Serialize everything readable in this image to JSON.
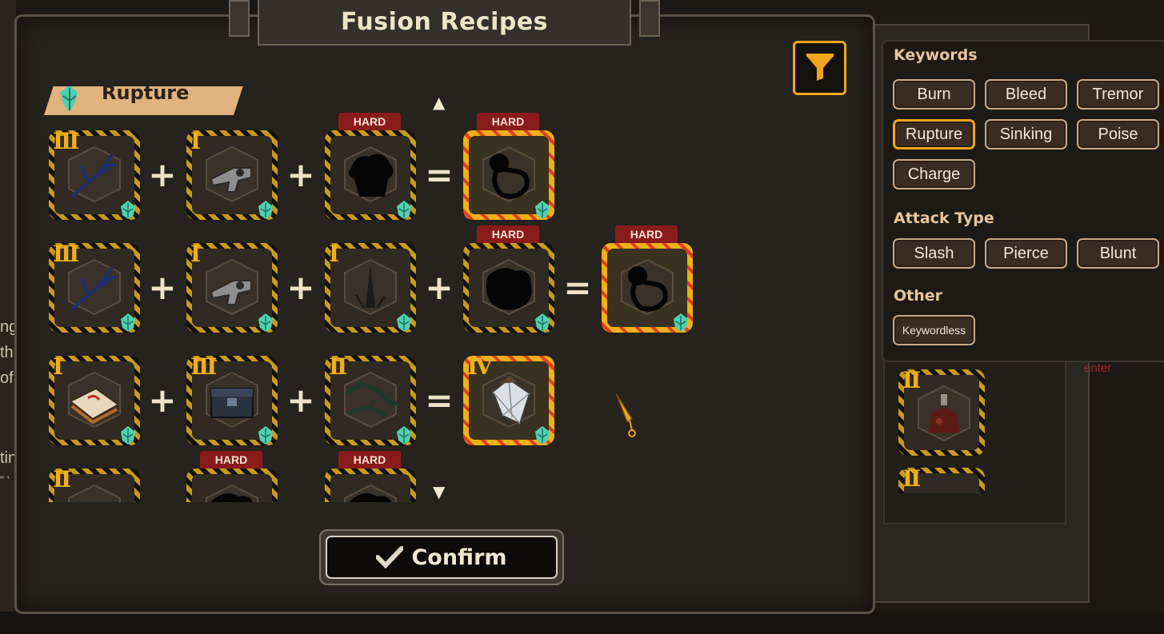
{
  "title": "Fusion Recipes",
  "section": {
    "label": "Rupture"
  },
  "hard_label": "HARD",
  "recipes": [
    {
      "ingredients": [
        {
          "tier": "III",
          "hard": false,
          "art": "branch"
        },
        {
          "tier": "I",
          "hard": false,
          "art": "gun"
        },
        {
          "tier": "",
          "hard": true,
          "art": "silhouette-tree"
        }
      ],
      "result": {
        "tier": "",
        "hard": true,
        "art": "silhouette-ring"
      }
    },
    {
      "ingredients": [
        {
          "tier": "III",
          "hard": false,
          "art": "branch"
        },
        {
          "tier": "I",
          "hard": false,
          "art": "gun"
        },
        {
          "tier": "I",
          "hard": false,
          "art": "spike"
        },
        {
          "tier": "",
          "hard": true,
          "art": "silhouette-blob"
        }
      ],
      "result": {
        "tier": "",
        "hard": true,
        "art": "silhouette-ring"
      }
    },
    {
      "ingredients": [
        {
          "tier": "I",
          "hard": false,
          "art": "book"
        },
        {
          "tier": "III",
          "hard": false,
          "art": "box"
        },
        {
          "tier": "II",
          "hard": false,
          "art": "thorns"
        }
      ],
      "result": {
        "tier": "IV",
        "hard": false,
        "art": "crystal"
      }
    },
    {
      "ingredients": [
        {
          "tier": "II",
          "hard": false,
          "art": "misc"
        },
        {
          "tier": "",
          "hard": true,
          "art": "silhouette-blob"
        },
        {
          "tier": "",
          "hard": true,
          "art": "silhouette-blob"
        }
      ],
      "result": null
    }
  ],
  "confirm_label": "Confirm",
  "filters": {
    "keywords_title": "Keywords",
    "keywords": [
      "Burn",
      "Bleed",
      "Tremor",
      "Rupture",
      "Sinking",
      "Poise",
      "Charge"
    ],
    "active_keyword": "Rupture",
    "attack_title": "Attack Type",
    "attack_types": [
      "Slash",
      "Pierce",
      "Blunt"
    ],
    "other_title": "Other",
    "other": [
      "Keywordless"
    ]
  },
  "background": {
    "side_text": [
      "ng",
      "th",
      "of",
      "tin",
      "\" '"
    ],
    "red_text": "enter",
    "side_tiers": [
      "II",
      "II"
    ]
  },
  "colors": {
    "accent": "#f0a41c",
    "hard": "#8a1b1b",
    "tier": "#f0b01a",
    "section": "#e0b27e"
  }
}
